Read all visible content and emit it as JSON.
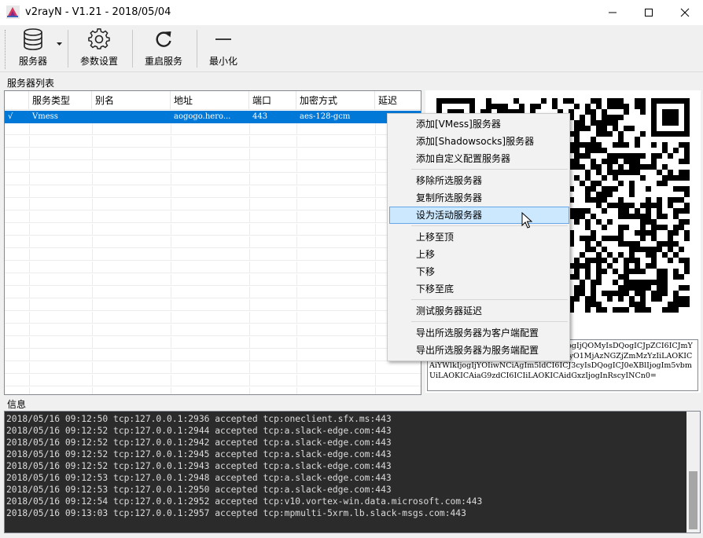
{
  "window": {
    "title": "v2rayN - V1.21 - 2018/05/04",
    "controls": [
      "minimize-icon",
      "maximize-icon",
      "close-icon"
    ]
  },
  "toolbar": {
    "servers_label": "服务器",
    "settings_label": "参数设置",
    "restart_label": "重启服务",
    "minimize_label": "最小化"
  },
  "server_list": {
    "section_label": "服务器列表",
    "columns": [
      "服务类型",
      "别名",
      "地址",
      "端口",
      "加密方式",
      "延迟"
    ],
    "rows": [
      {
        "active": "√",
        "type": "Vmess",
        "alias": "",
        "address": "aogogo.hero...",
        "port": "443",
        "security": "aes-128-gcm",
        "delay": ""
      }
    ]
  },
  "vmess_link_text": "…AgImFkZCI6ICJhb2dvZ28uaGVy…ogIjQOMyIsDQogICJpZCI6ICJmYTExOWI4MiIkNWZiLTQ4Y2YtODI5NyO1MjAzNGZjZmMzYzIiLAOKICAiYWlkIjogIjYOIiwNCiAgIm5ldCI6ICJ3cyIsDQogICJ0eXBlIjogIm5vbmUiLAOKICAiaG9zdCI6ICIiLAOKICAidGxzIjogInRscyINCn0=",
  "context_menu": {
    "items": [
      "添加[VMess]服务器",
      "添加[Shadowsocks]服务器",
      "添加自定义配置服务器",
      "移除所选服务器",
      "复制所选服务器",
      "设为活动服务器",
      "上移至顶",
      "上移",
      "下移",
      "下移至底",
      "测试服务器延迟",
      "导出所选服务器为客户端配置",
      "导出所选服务器为服务端配置"
    ],
    "hovered_item": "设为活动服务器"
  },
  "info": {
    "section_label": "信息",
    "log_lines": [
      "2018/05/16 09:12:50 tcp:127.0.0.1:2936 accepted tcp:oneclient.sfx.ms:443",
      "2018/05/16 09:12:52 tcp:127.0.0.1:2944 accepted tcp:a.slack-edge.com:443",
      "2018/05/16 09:12:52 tcp:127.0.0.1:2942 accepted tcp:a.slack-edge.com:443",
      "2018/05/16 09:12:52 tcp:127.0.0.1:2945 accepted tcp:a.slack-edge.com:443",
      "2018/05/16 09:12:52 tcp:127.0.0.1:2943 accepted tcp:a.slack-edge.com:443",
      "2018/05/16 09:12:53 tcp:127.0.0.1:2948 accepted tcp:a.slack-edge.com:443",
      "2018/05/16 09:12:53 tcp:127.0.0.1:2950 accepted tcp:a.slack-edge.com:443",
      "2018/05/16 09:12:54 tcp:127.0.0.1:2952 accepted tcp:v10.vortex-win.data.microsoft.com:443",
      "2018/05/16 09:13:03 tcp:127.0.0.1:2957 accepted tcp:mpmulti-5xrm.lb.slack-msgs.com:443"
    ]
  },
  "colors": {
    "selection": "#0078d7",
    "menu_hover": "#cce8ff",
    "log_background": "#2b2b2b"
  }
}
